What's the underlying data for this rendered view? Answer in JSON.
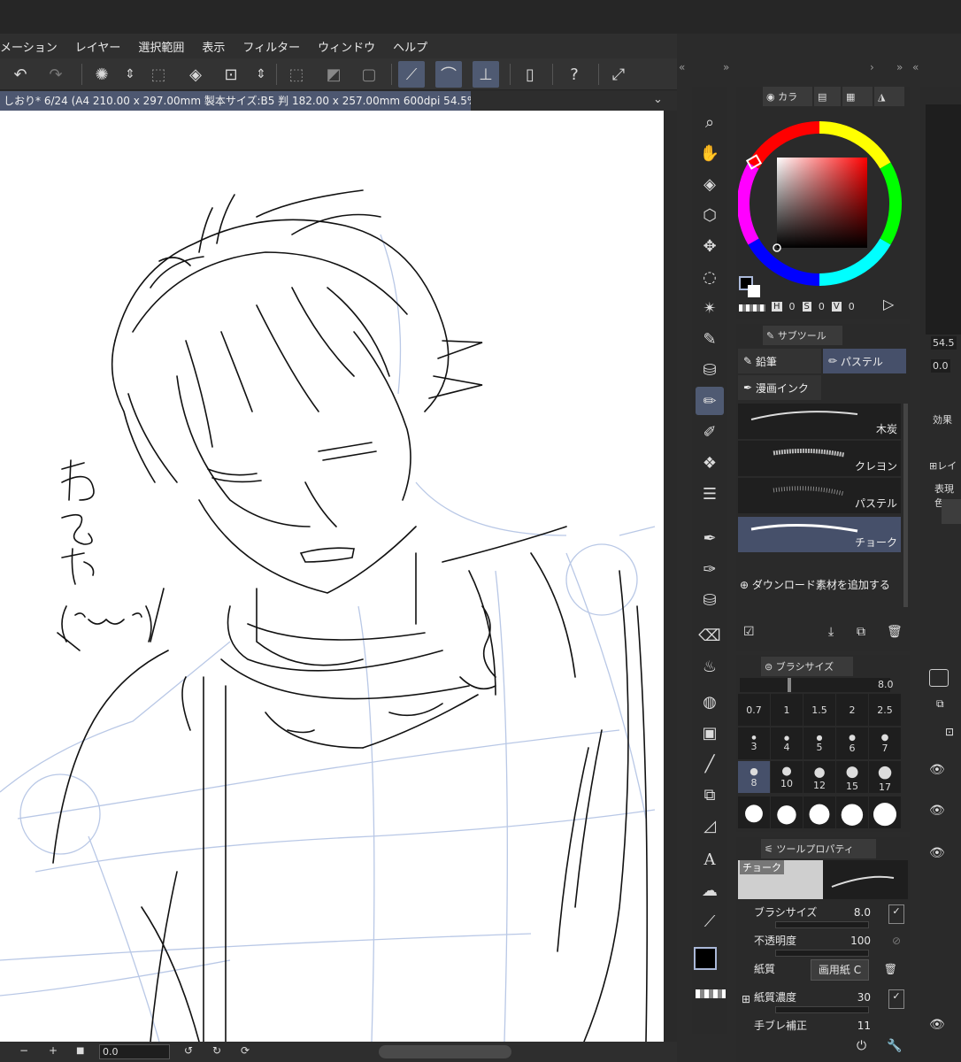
{
  "menu": [
    "メーション",
    "レイヤー",
    "選択範囲",
    "表示",
    "フィルター",
    "ウィンドウ",
    "ヘルプ"
  ],
  "document": {
    "tab_label": "しおり* 6/24 (A4 210.00 x 297.00mm 製本サイズ:B5 判 182.00 x 257.00mm 600dpi 54.5%)"
  },
  "canvas": {
    "handwritten_text": "ねるお (^ω^)"
  },
  "status": {
    "minus": "−",
    "plus": "+",
    "rotation": "0.0"
  },
  "color_panel": {
    "tab_label": "カラ",
    "hsv_h_label": "H",
    "hsv_h": "0",
    "hsv_s_label": "S",
    "hsv_s": "0",
    "hsv_v_label": "V",
    "hsv_v": "0",
    "main_color": "#000000",
    "sub_color": "#ffffff"
  },
  "subtool": {
    "tab_label": "サブツール",
    "groups": [
      "鉛筆",
      "パステル",
      "漫画インク"
    ],
    "brushes": [
      "木炭",
      "クレヨン",
      "パステル",
      "チョーク"
    ],
    "add_material": "ダウンロード素材を追加する"
  },
  "brush_size": {
    "tab_label": "ブラシサイズ",
    "current": "8.0",
    "sizes": [
      "0.7",
      "1",
      "1.5",
      "2",
      "2.5",
      "3",
      "4",
      "5",
      "6",
      "7",
      "8",
      "10",
      "12",
      "15",
      "17"
    ]
  },
  "tool_property": {
    "tab_label": "ツールプロパティ",
    "preview_name": "チョーク",
    "rows": [
      {
        "label": "ブラシサイズ",
        "value": "8.0"
      },
      {
        "label": "不透明度",
        "value": "100"
      },
      {
        "label": "紙質",
        "value": "画用紙 C"
      },
      {
        "label": "紙質濃度",
        "value": "30"
      },
      {
        "label": "手ブレ補正",
        "value": "11"
      }
    ]
  },
  "right_edge": {
    "zoom": "54.5",
    "angle": "0.0",
    "effect_label": "効果",
    "layer_label": "レイ",
    "expression_label": "表現色"
  }
}
